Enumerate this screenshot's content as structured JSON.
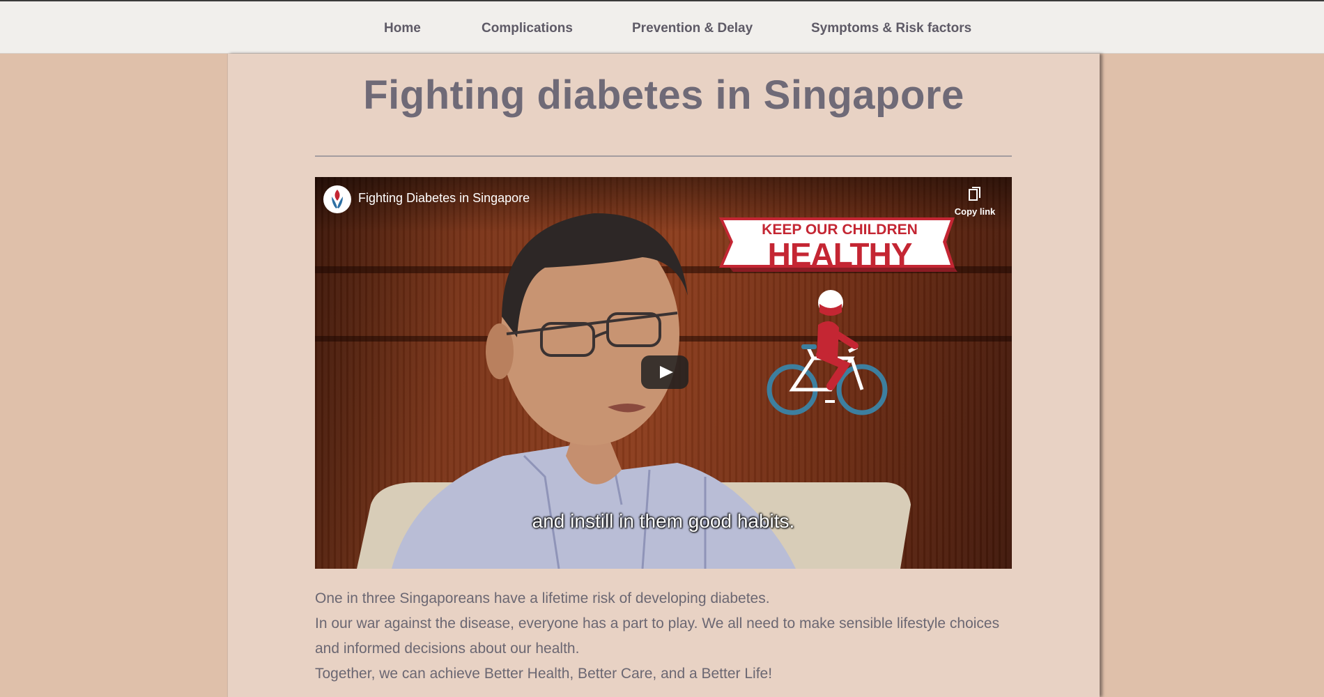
{
  "nav": {
    "items": [
      {
        "label": "Home"
      },
      {
        "label": "Complications"
      },
      {
        "label": "Prevention & Delay"
      },
      {
        "label": "Symptoms & Risk factors"
      }
    ]
  },
  "page": {
    "title": "Fighting diabetes in Singapore"
  },
  "video": {
    "title": "Fighting Diabetes in Singapore",
    "copy_link_label": "Copy link",
    "banner_line1": "KEEP OUR CHILDREN",
    "banner_line2": "HEALTHY",
    "subtitle": "and instill in them good habits."
  },
  "body": {
    "paragraphs": [
      "One in three Singaporeans have a lifetime risk of developing diabetes.",
      "In our war against the disease, everyone has a part to play. We all need to make sensible lifestyle choices and informed decisions about our health.",
      "Together, we can achieve Better Health, Better Care, and a Better Life!"
    ]
  },
  "colors": {
    "page_bg": "#dfc0aa",
    "panel_bg": "#e8d2c4",
    "nav_bg": "#f1efec",
    "title_text": "#6f6a77",
    "banner_red": "#c42633",
    "bike_blue": "#3d7f9f"
  }
}
